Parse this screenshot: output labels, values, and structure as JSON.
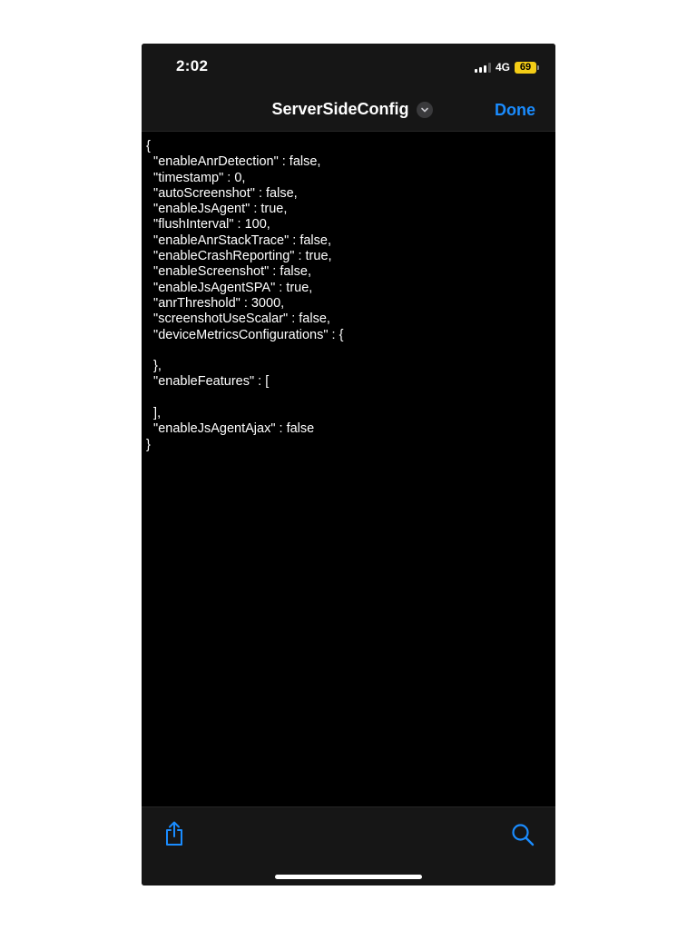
{
  "status_bar": {
    "time": "2:02",
    "network": "4G",
    "battery_level": "69"
  },
  "nav": {
    "title": "ServerSideConfig",
    "done_label": "Done"
  },
  "document": {
    "lines": [
      "{",
      "  \"enableAnrDetection\" : false,",
      "  \"timestamp\" : 0,",
      "  \"autoScreenshot\" : false,",
      "  \"enableJsAgent\" : true,",
      "  \"flushInterval\" : 100,",
      "  \"enableAnrStackTrace\" : false,",
      "  \"enableCrashReporting\" : true,",
      "  \"enableScreenshot\" : false,",
      "  \"enableJsAgentSPA\" : true,",
      "  \"anrThreshold\" : 3000,",
      "  \"screenshotUseScalar\" : false,",
      "  \"deviceMetricsConfigurations\" : {",
      "",
      "  },",
      "  \"enableFeatures\" : [",
      "",
      "  ],",
      "  \"enableJsAgentAjax\" : false",
      "}"
    ]
  },
  "colors": {
    "accent": "#1a8cff",
    "battery": "#f4cd16",
    "background": "#000000",
    "bar_background": "#161616"
  },
  "icons": {
    "share": "share-icon",
    "search": "search-icon",
    "chevron": "chevron-down-icon"
  }
}
